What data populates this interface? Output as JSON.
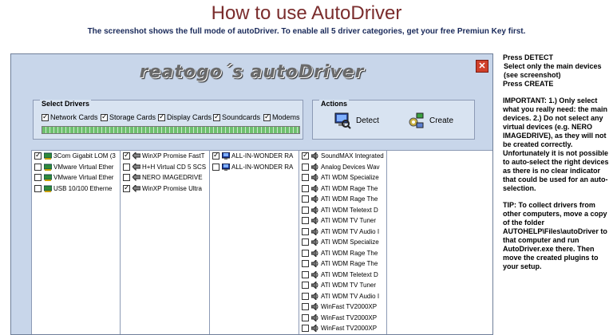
{
  "header": {
    "title": "How to use AutoDriver",
    "subtitle": "The screenshot shows the full mode of autoDriver. To enable all 5 driver categories, get your free Premiun Key first."
  },
  "window": {
    "logo_text": "reatogo´s autoDriver",
    "close_label": "✕",
    "select_drivers": {
      "title": "Select Drivers",
      "categories": [
        {
          "label": "Network Cards",
          "checked": true
        },
        {
          "label": "Storage Cards",
          "checked": true
        },
        {
          "label": "Display Cards",
          "checked": true
        },
        {
          "label": "Soundcards",
          "checked": true
        },
        {
          "label": "Modems",
          "checked": true
        }
      ]
    },
    "actions": {
      "title": "Actions",
      "detect_label": "Detect",
      "create_label": "Create"
    },
    "lists": {
      "network": [
        {
          "label": "3Com Gigabit LOM (3",
          "checked": true
        },
        {
          "label": "VMware Virtual Ether",
          "checked": false
        },
        {
          "label": "VMware Virtual Ether",
          "checked": false
        },
        {
          "label": "USB 10/100 Etherne",
          "checked": false
        }
      ],
      "storage": [
        {
          "label": "WinXP Promise FastT",
          "checked": true
        },
        {
          "label": "H+H Virtual CD 5 SCS",
          "checked": false
        },
        {
          "label": "NERO IMAGEDRIVE",
          "checked": false
        },
        {
          "label": "WinXP Promise Ultra",
          "checked": true
        }
      ],
      "display": [
        {
          "label": "ALL-IN-WONDER RA",
          "checked": true
        },
        {
          "label": "ALL-IN-WONDER RA",
          "checked": false
        }
      ],
      "sound": [
        {
          "label": "SoundMAX Integrated",
          "checked": true
        },
        {
          "label": "Analog Devices Wav",
          "checked": false
        },
        {
          "label": "ATI WDM Specialize",
          "checked": false
        },
        {
          "label": "ATI WDM Rage The",
          "checked": false
        },
        {
          "label": "ATI WDM Rage The",
          "checked": false
        },
        {
          "label": "ATI WDM Teletext D",
          "checked": false
        },
        {
          "label": "ATI WDM TV Tuner",
          "checked": false
        },
        {
          "label": "ATI WDM TV Audio I",
          "checked": false
        },
        {
          "label": "ATI WDM Specialize",
          "checked": false
        },
        {
          "label": "ATI WDM Rage The",
          "checked": false
        },
        {
          "label": "ATI WDM Rage The",
          "checked": false
        },
        {
          "label": "ATI WDM Teletext D",
          "checked": false
        },
        {
          "label": "ATI WDM TV Tuner",
          "checked": false
        },
        {
          "label": "ATI WDM TV Audio I",
          "checked": false
        },
        {
          "label": "WinFast TV2000XP",
          "checked": false
        },
        {
          "label": "WinFast TV2000XP",
          "checked": false
        },
        {
          "label": "WinFast TV2000XP",
          "checked": false
        }
      ]
    }
  },
  "instructions": {
    "p1": "Press DETECT",
    "p2": "Select only the main devices (see screenshot)",
    "p3": "Press CREATE",
    "p4": "IMPORTANT: 1.) Only select what you really need: the main devices. 2.) Do not select any virtual devices (e.g. NERO IMAGEDRIVE), as they will not be created correctly.",
    "p5": "Unfortunately it is not possible to auto-select the right devices as there is no clear indicator that could be used for an auto-selection.",
    "p6": "TIP: To collect drivers from other computers, move a copy of the folder AUTOHELP\\Files\\autoDriver to that computer and run AutoDriver.exe there. Then move the created plugins to your setup."
  },
  "colors": {
    "title": "#7a2c2c",
    "window_bg": "#c8d6ea",
    "close": "#d0402a",
    "progress": "#6ec06e"
  }
}
